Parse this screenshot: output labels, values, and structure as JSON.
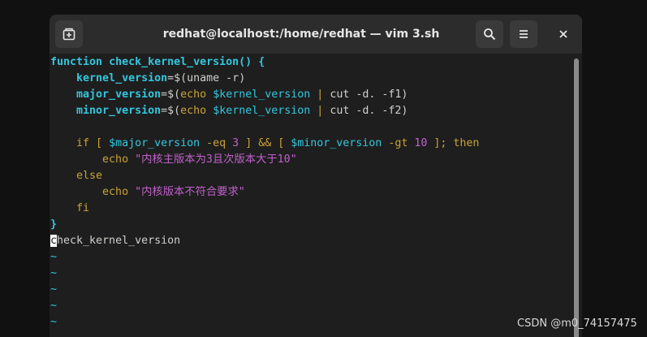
{
  "window": {
    "title": "redhat@localhost:/home/redhat — vim 3.sh",
    "buttons": {
      "new_tab_icon": "new-tab-icon",
      "search_icon": "search-icon",
      "menu_icon": "hamburger-menu-icon",
      "close_glyph": "×"
    }
  },
  "editor": {
    "l1": {
      "kw": "function",
      "sp": " ",
      "fn": "check_kernel_version()",
      "rest": " {"
    },
    "l2": {
      "indent": "    ",
      "var": "kernel_version",
      "eq": "=",
      "op": "$(",
      "cmd": "uname -r",
      "close": ")"
    },
    "l3": {
      "indent": "    ",
      "var": "major_version",
      "eq": "=",
      "op": "$(",
      "kw": "echo",
      "sp": " ",
      "ref": "$kernel_version",
      "pipe": " | ",
      "cmd": "cut -d. -f1",
      "close": ")"
    },
    "l4": {
      "indent": "    ",
      "var": "minor_version",
      "eq": "=",
      "op": "$(",
      "kw": "echo",
      "sp": " ",
      "ref": "$kernel_version",
      "pipe": " | ",
      "cmd": "cut -d. -f2",
      "close": ")"
    },
    "l6": {
      "indent": "    ",
      "a": "if [ ",
      "b": "$major_version",
      "c": " -eq ",
      "d": "3",
      "e": " ] && [ ",
      "f": "$minor_version",
      "g": " -gt ",
      "h": "10",
      "i": " ]; then"
    },
    "l7": {
      "indent": "        ",
      "kw": "echo",
      "sp": " ",
      "str": "\"内核主版本为3且次版本大于10\""
    },
    "l8": {
      "indent": "    ",
      "kw": "else"
    },
    "l9": {
      "indent": "        ",
      "kw": "echo",
      "sp": " ",
      "str": "\"内核版本不符合要求\""
    },
    "l10": {
      "indent": "    ",
      "kw": "fi"
    },
    "l11": {
      "brace": "}"
    },
    "l12": {
      "cursor_char": "c",
      "rest": "heck_kernel_version"
    },
    "tilde": "~"
  },
  "watermark": "CSDN @m0_74157475",
  "colors": {
    "keyword": "#c9a336",
    "identifier": "#33c7de",
    "string": "#c061cb",
    "plain": "#d0cfcc",
    "background": "#1e1e1e"
  }
}
